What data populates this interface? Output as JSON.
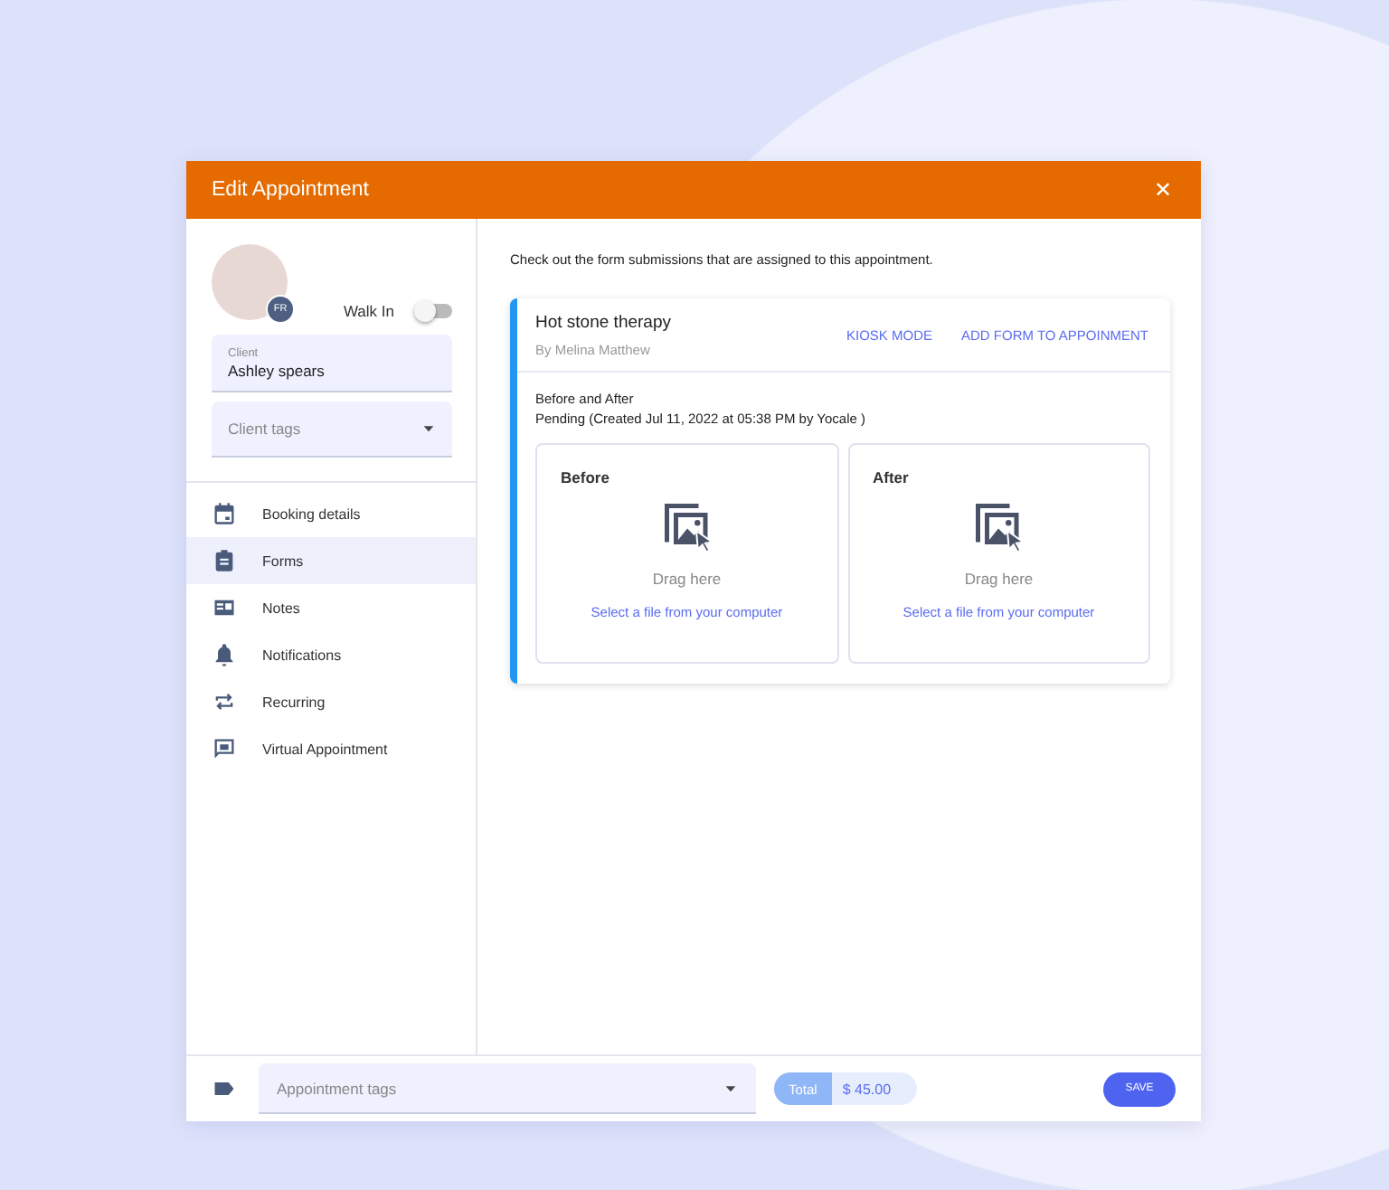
{
  "dialog": {
    "title": "Edit Appointment",
    "close": "✕"
  },
  "client": {
    "avatar_initials": "FR",
    "walk_in": {
      "label": "Walk In",
      "on": false
    },
    "client_field": {
      "label": "Client",
      "value": "Ashley spears"
    },
    "tags_field": {
      "placeholder": "Client tags"
    }
  },
  "sidebar": {
    "items": [
      {
        "label": "Booking details",
        "selected": false
      },
      {
        "label": "Forms",
        "selected": true
      },
      {
        "label": "Notes",
        "selected": false
      },
      {
        "label": "Notifications",
        "selected": false
      },
      {
        "label": "Recurring",
        "selected": false
      },
      {
        "label": "Virtual Appointment",
        "selected": false
      }
    ]
  },
  "intro": "Check out the form submissions that are assigned to this appointment.",
  "form_card": {
    "title": "Hot stone therapy",
    "author": "By Melina Matthew",
    "actions": [
      "KIOSK MODE",
      "ADD FORM TO APPOINMENT"
    ],
    "form_name": "Before and After",
    "status": "Pending (Created Jul 11, 2022 at 05:38 PM by Yocale )",
    "uploads": [
      {
        "title": "Before",
        "hint": "Drag here",
        "link": "Select a file from your computer"
      },
      {
        "title": "After",
        "hint": "Drag here",
        "link": "Select a file from your computer"
      }
    ]
  },
  "footer": {
    "tags_placeholder": "Appointment tags",
    "total_label": "Total",
    "total_value": "$ 45.00",
    "save": "SAVE"
  }
}
